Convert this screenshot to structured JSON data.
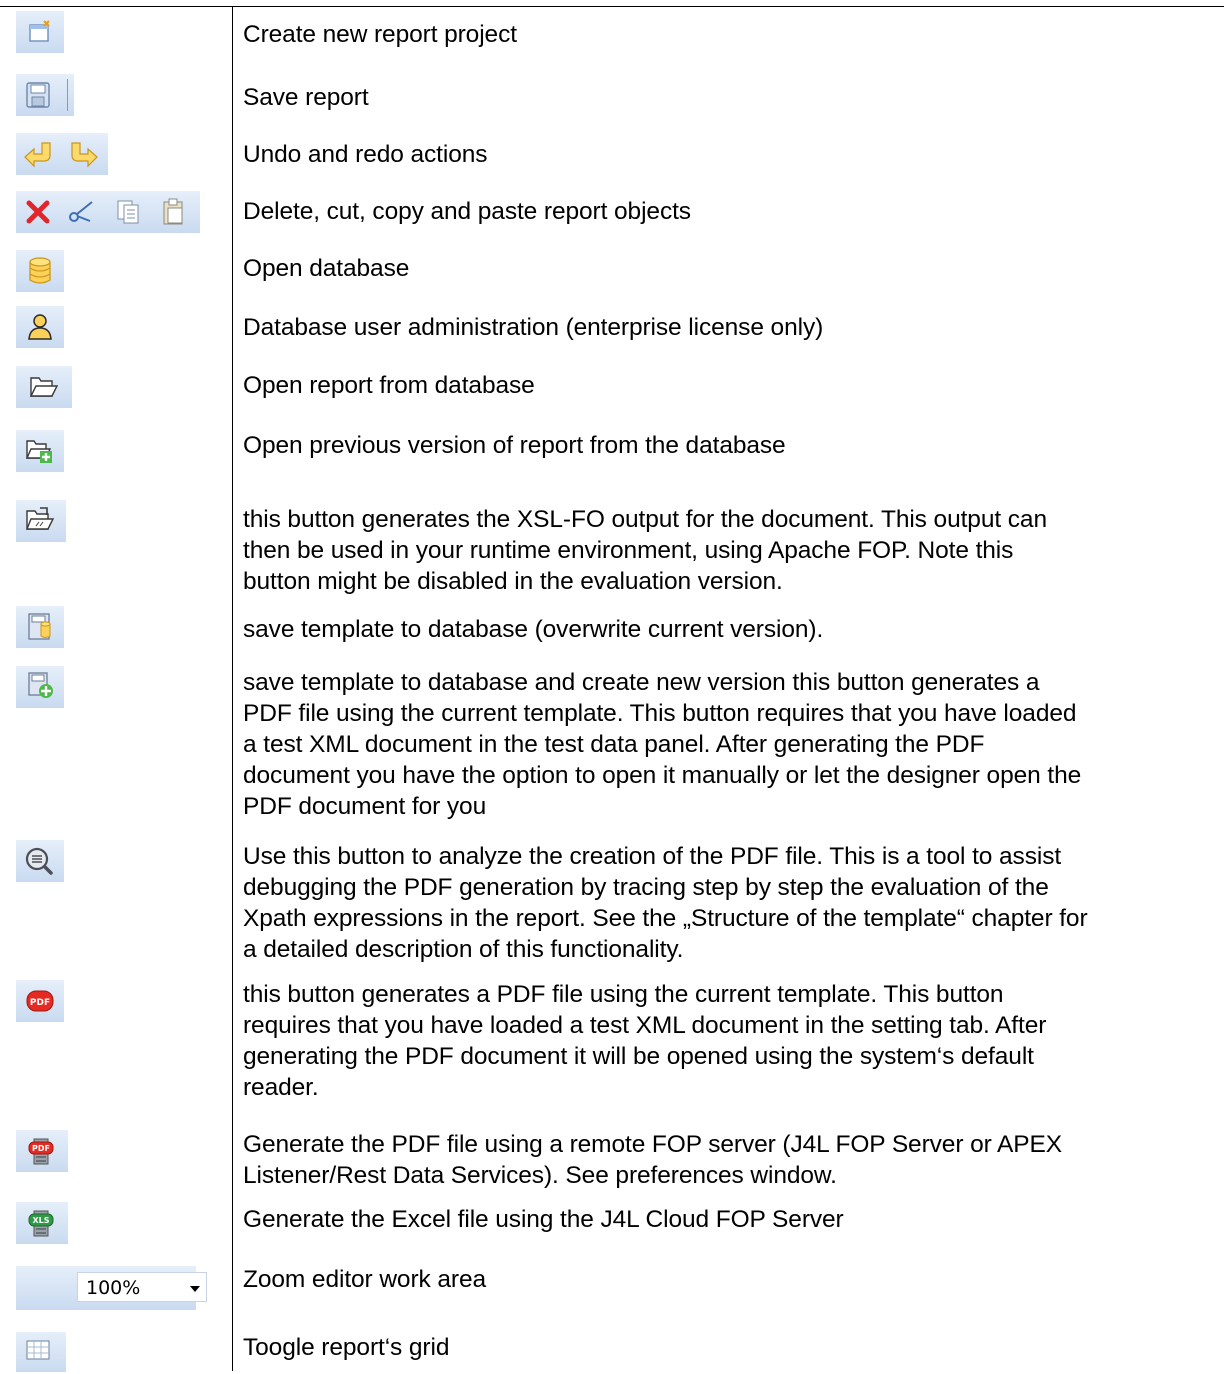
{
  "rows": [
    {
      "icons": [
        "new-report-project-icon"
      ],
      "description": "Create new report project"
    },
    {
      "icons": [
        "save-disk-icon"
      ],
      "description": "Save report"
    },
    {
      "icons": [
        "undo-arrow-icon",
        "redo-arrow-icon"
      ],
      "description": "Undo and redo actions"
    },
    {
      "icons": [
        "delete-x-icon",
        "cut-scissors-icon",
        "copy-icon",
        "paste-icon"
      ],
      "description": "Delete, cut, copy and paste report objects"
    },
    {
      "icons": [
        "database-icon"
      ],
      "description": "Open database"
    },
    {
      "icons": [
        "user-admin-icon"
      ],
      "description": "Database user administration (enterprise license only)"
    },
    {
      "icons": [
        "folder-open-icon"
      ],
      "description": "Open report from database"
    },
    {
      "icons": [
        "folder-version-icon"
      ],
      "description": "Open previous version of report from the database"
    },
    {
      "icons": [
        "fo-export-icon"
      ],
      "description": [
        "this button generates the XSL-FO output for the document. This output can",
        "then be used in your runtime environment, using Apache FOP. Note this",
        "button might be disabled in the evaluation version."
      ]
    },
    {
      "icons": [
        "save-template-db-icon"
      ],
      "description": "save template to database (overwrite current version)."
    },
    {
      "icons": [
        "save-new-version-icon"
      ],
      "description": [
        "save template to database and create new version this button generates a",
        "PDF file using the current template. This button requires that you have loaded",
        "a test XML document in the test data panel. After generating the PDF",
        "document you have the option to open it manually or let the designer open the",
        "PDF document for you"
      ]
    },
    {
      "icons": [
        "analyze-magnifier-icon"
      ],
      "description": [
        "Use this button to analyze the creation of the PDF file. This is a tool to assist",
        "debugging the PDF generation by tracing step by step the evaluation of the",
        "Xpath expressions in the report. See the „Structure of the template“ chapter for",
        "a detailed description of this functionality."
      ]
    },
    {
      "icons": [
        "pdf-icon"
      ],
      "description": [
        "this button generates a PDF file using the current template. This button",
        "requires that you have loaded a test XML document in the setting tab. After",
        "generating the PDF document  it will be opened using the system‘s default",
        "reader."
      ]
    },
    {
      "icons": [
        "remote-pdf-server-icon"
      ],
      "description": [
        "Generate the PDF file using a remote FOP server (J4L FOP Server or APEX",
        "Listener/Rest Data Services). See preferences window."
      ]
    },
    {
      "icons": [
        "excel-cloud-server-icon"
      ],
      "description": "Generate the Excel file using the J4L Cloud FOP Server"
    },
    {
      "icons": [
        "zoom-dropdown-icon"
      ],
      "zoom_value": "100%",
      "description": "Zoom editor work area"
    },
    {
      "icons": [
        "grid-toggle-icon"
      ],
      "description": "Toogle report‘s grid"
    }
  ]
}
